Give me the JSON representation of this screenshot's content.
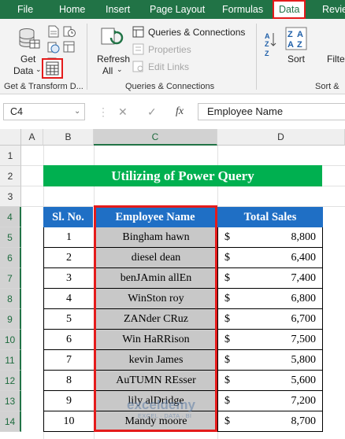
{
  "ribbon_tabs": [
    "File",
    "Home",
    "Insert",
    "Page Layout",
    "Formulas",
    "Data",
    "Revie"
  ],
  "active_tab": "Data",
  "ribbon": {
    "get_data_line1": "Get",
    "get_data_line2": "Data",
    "group_get_transform": "Get & Transform D...",
    "refresh_line1": "Refresh",
    "refresh_line2": "All",
    "queries_connections": "Queries & Connections",
    "properties": "Properties",
    "edit_links": "Edit Links",
    "group_queries": "Queries & Connections",
    "sort": "Sort",
    "filter": "Filte",
    "group_sort": "Sort &"
  },
  "formula_bar": {
    "name_box": "C4",
    "cancel_icon": "✕",
    "enter_icon": "✓",
    "fx": "fx",
    "formula": "Employee Name"
  },
  "columns": [
    "A",
    "B",
    "C",
    "D"
  ],
  "rows": [
    "1",
    "2",
    "3",
    "4",
    "5",
    "6",
    "7",
    "8",
    "9",
    "10",
    "11",
    "12",
    "13",
    "14"
  ],
  "sheet": {
    "title": "Utilizing of Power Query",
    "headers": [
      "Sl. No.",
      "Employee Name",
      "Total Sales"
    ],
    "records": [
      {
        "sl": "1",
        "name": "Bingham hawn",
        "cur": "$",
        "sales": "8,800"
      },
      {
        "sl": "2",
        "name": "diesel dean",
        "cur": "$",
        "sales": "6,400"
      },
      {
        "sl": "3",
        "name": "benJAmin allEn",
        "cur": "$",
        "sales": "7,400"
      },
      {
        "sl": "4",
        "name": "WinSton roy",
        "cur": "$",
        "sales": "6,800"
      },
      {
        "sl": "5",
        "name": "ZANder CRuz",
        "cur": "$",
        "sales": "6,700"
      },
      {
        "sl": "6",
        "name": "Win HaRRison",
        "cur": "$",
        "sales": "7,500"
      },
      {
        "sl": "7",
        "name": "kevin James",
        "cur": "$",
        "sales": "5,800"
      },
      {
        "sl": "8",
        "name": "AuTUMN REsser",
        "cur": "$",
        "sales": "5,600"
      },
      {
        "sl": "9",
        "name": "lily alDridge",
        "cur": "$",
        "sales": "7,200"
      },
      {
        "sl": "10",
        "name": "Mandy moore",
        "cur": "$",
        "sales": "8,700"
      }
    ]
  },
  "watermark": {
    "main": "exceldemy",
    "sub": "EXCEL · DATA · BI"
  },
  "colors": {
    "excel_green": "#217346",
    "title_green": "#00b050",
    "header_blue": "#1f6fc5",
    "highlight_red": "#e41b1b",
    "name_gray": "#c8c8c8"
  }
}
